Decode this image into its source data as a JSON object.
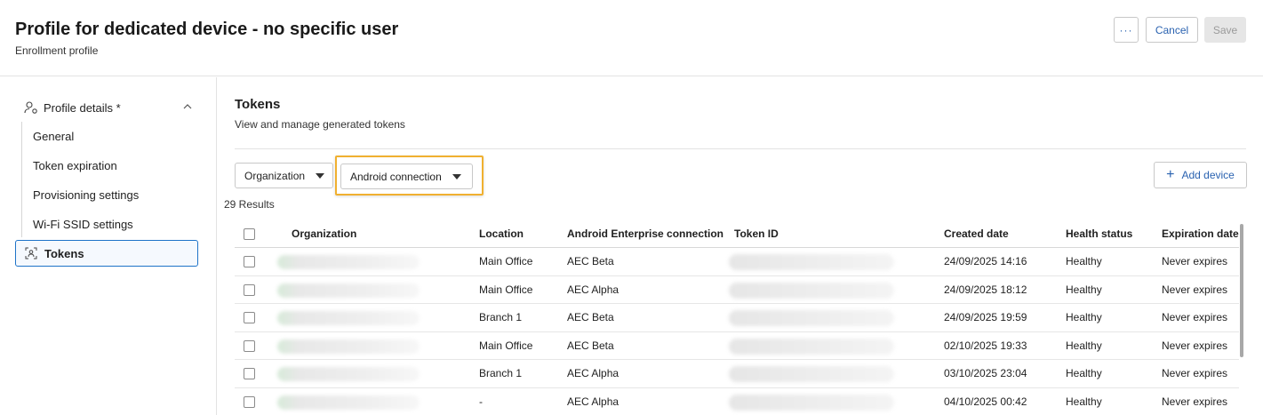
{
  "header": {
    "title": "Profile for dedicated device - no specific user",
    "subtitle": "Enrollment profile",
    "more_label": "···",
    "cancel_label": "Cancel",
    "save_label": "Save"
  },
  "sidebar": {
    "section_label": "Profile details *",
    "section_icon": "user-settings-icon",
    "items": [
      {
        "label": "General"
      },
      {
        "label": "Token expiration"
      },
      {
        "label": "Provisioning settings"
      },
      {
        "label": "Wi-Fi SSID settings"
      },
      {
        "label": "Tokens",
        "icon": "token-icon",
        "active": true
      }
    ]
  },
  "main": {
    "title": "Tokens",
    "subtitle": "View and manage generated tokens",
    "filters": [
      {
        "label": "Organization"
      },
      {
        "label": "Android connection"
      }
    ],
    "add_button_label": "Add device",
    "results_label": "29 Results",
    "table": {
      "columns": [
        "Organization",
        "Location",
        "Android Enterprise connection",
        "Token ID",
        "Created date",
        "Health status",
        "Expiration date"
      ],
      "rows": [
        {
          "location": "Main Office",
          "aec": "AEC Beta",
          "created": "24/09/2025 14:16",
          "health": "Healthy",
          "expiration": "Never expires"
        },
        {
          "location": "Main Office",
          "aec": "AEC Alpha",
          "created": "24/09/2025 18:12",
          "health": "Healthy",
          "expiration": "Never expires"
        },
        {
          "location": "Branch 1",
          "aec": "AEC Beta",
          "created": "24/09/2025 19:59",
          "health": "Healthy",
          "expiration": "Never expires"
        },
        {
          "location": "Main Office",
          "aec": "AEC Beta",
          "created": "02/10/2025 19:33",
          "health": "Healthy",
          "expiration": "Never expires"
        },
        {
          "location": "Branch 1",
          "aec": "AEC Alpha",
          "created": "03/10/2025 23:04",
          "health": "Healthy",
          "expiration": "Never expires"
        },
        {
          "location": "-",
          "aec": "AEC Alpha",
          "created": "04/10/2025 00:42",
          "health": "Healthy",
          "expiration": "Never expires"
        }
      ]
    }
  },
  "colors": {
    "accent": "#2a62b0",
    "active_border": "#1e73c8",
    "highlight": "#f0b030"
  }
}
